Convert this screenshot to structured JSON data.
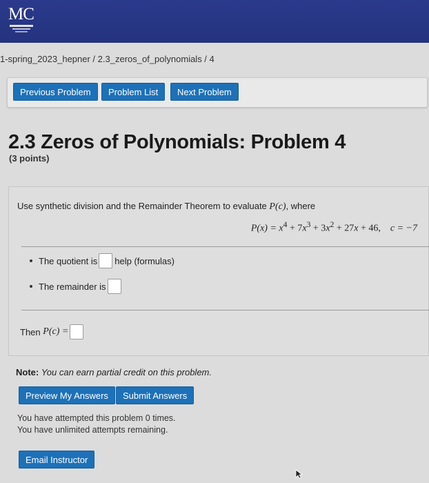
{
  "header": {
    "logo_text": "MC"
  },
  "breadcrumb": "1-spring_2023_hepner / 2.3_zeros_of_polynomials / 4",
  "nav": {
    "previous": "Previous Problem",
    "list": "Problem List",
    "next": "Next Problem"
  },
  "problem": {
    "title": "2.3 Zeros of Polynomials: Problem 4",
    "points": "(3 points)",
    "prompt_pre": "Use synthetic division and the Remainder Theorem to evaluate",
    "prompt_math": "P(c)",
    "prompt_post": ", where",
    "equation_lhs": "P(x) = x",
    "c_value": "c = −7",
    "quotient_label": "The quotient is",
    "help_label": "help (formulas)",
    "remainder_label": "The remainder is",
    "then_label": "Then",
    "then_math": "P(c) ="
  },
  "note": {
    "label": "Note:",
    "text": "You can earn partial credit on this problem."
  },
  "actions": {
    "preview": "Preview My Answers",
    "submit": "Submit Answers",
    "email": "Email Instructor"
  },
  "attempts": {
    "line1": "You have attempted this problem 0 times.",
    "line2": "You have unlimited attempts remaining."
  }
}
